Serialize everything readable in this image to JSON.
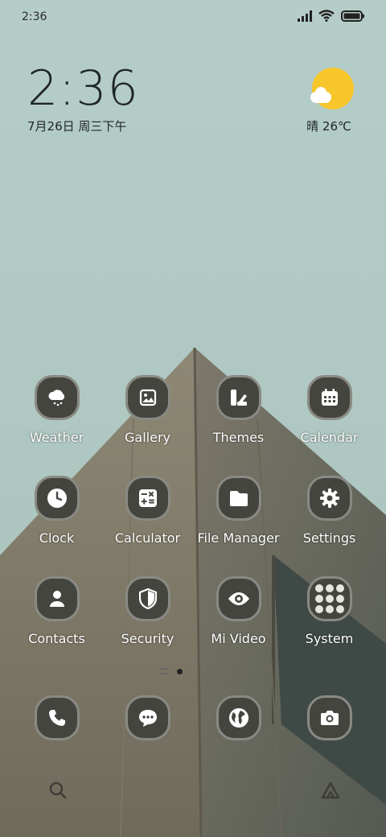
{
  "status_bar": {
    "time": "2:36"
  },
  "clock_widget": {
    "time": "2:36",
    "date": "7月26日 周三下午"
  },
  "weather_widget": {
    "condition_temp": "晴 26℃"
  },
  "apps": [
    {
      "name": "Weather",
      "icon": "cloud-rain-icon"
    },
    {
      "name": "Gallery",
      "icon": "image-icon"
    },
    {
      "name": "Themes",
      "icon": "palette-icon"
    },
    {
      "name": "Calendar",
      "icon": "calendar-icon"
    },
    {
      "name": "Clock",
      "icon": "clock-icon"
    },
    {
      "name": "Calculator",
      "icon": "calculator-icon"
    },
    {
      "name": "File Manager",
      "icon": "folder-icon"
    },
    {
      "name": "Settings",
      "icon": "gear-icon"
    },
    {
      "name": "Contacts",
      "icon": "person-icon"
    },
    {
      "name": "Security",
      "icon": "shield-icon"
    },
    {
      "name": "Mi Video",
      "icon": "eye-icon"
    },
    {
      "name": "System",
      "icon": "folder-grid-icon"
    }
  ],
  "dock": [
    {
      "icon": "phone-icon"
    },
    {
      "icon": "message-icon"
    },
    {
      "icon": "globe-icon"
    },
    {
      "icon": "camera-icon"
    }
  ],
  "colors": {
    "sky": "#b3cbc6",
    "icon_bg": "#454540",
    "sun": "#f7c62b"
  }
}
